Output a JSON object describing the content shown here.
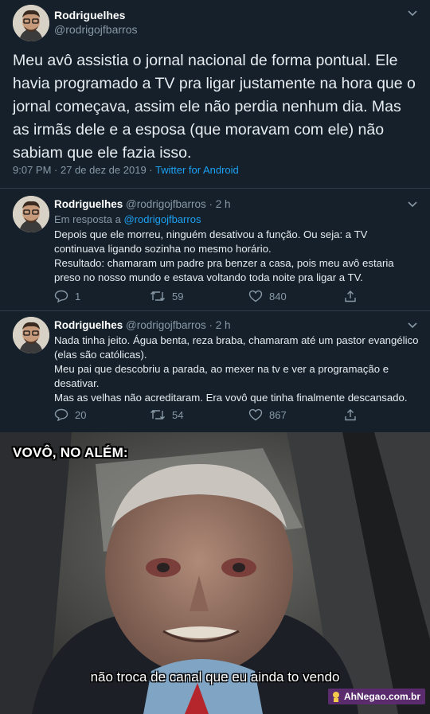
{
  "main_tweet": {
    "author_name": "Rodriguelhes",
    "author_handle": "@rodrigojfbarros",
    "text": "Meu avô assistia o jornal nacional de forma pontual. Ele havia programado a TV pra ligar justamente na hora que o jornal começava, assim ele não perdia nenhum dia. Mas as irmãs dele e a esposa (que moravam com ele) não sabiam que ele fazia isso.",
    "timestamp": "9:07 PM · 27 de dez de 2019 · ",
    "source": "Twitter for Android"
  },
  "replies": [
    {
      "author_name": "Rodriguelhes",
      "author_handle": "@rodrigojfbarros",
      "age": "· 2 h",
      "reply_to_prefix": "Em resposta a ",
      "reply_to_handle": "@rodrigojfbarros",
      "text": "Depois que ele morreu, ninguém desativou a função. Ou seja: a TV continuava ligando sozinha no mesmo horário.\nResultado: chamaram um padre pra benzer a casa, pois meu avô estaria preso no nosso mundo e estava voltando toda noite pra ligar a TV.",
      "replies_count": "1",
      "retweets_count": "59",
      "likes_count": "840"
    },
    {
      "author_name": "Rodriguelhes",
      "author_handle": "@rodrigojfbarros",
      "age": "· 2 h",
      "text": "Nada tinha jeito. Água benta, reza braba, chamaram até um pastor evangélico (elas são católicas).\nMeu pai que descobriu a parada, ao mexer na tv e ver a programação e desativar.\nMas as velhas não acreditaram. Era vovô que tinha finalmente descansado.",
      "replies_count": "20",
      "retweets_count": "54",
      "likes_count": "867"
    }
  ],
  "meme": {
    "top_caption": "VOVÔ, NO ALÉM:",
    "bottom_caption": "não troca de canal que eu ainda to vendo",
    "watermark": "AhNegao.com.br"
  },
  "colors": {
    "background": "#15202b",
    "link": "#1da1f2",
    "muted": "#8899a6",
    "watermark_bg": "#5a2c6e"
  }
}
